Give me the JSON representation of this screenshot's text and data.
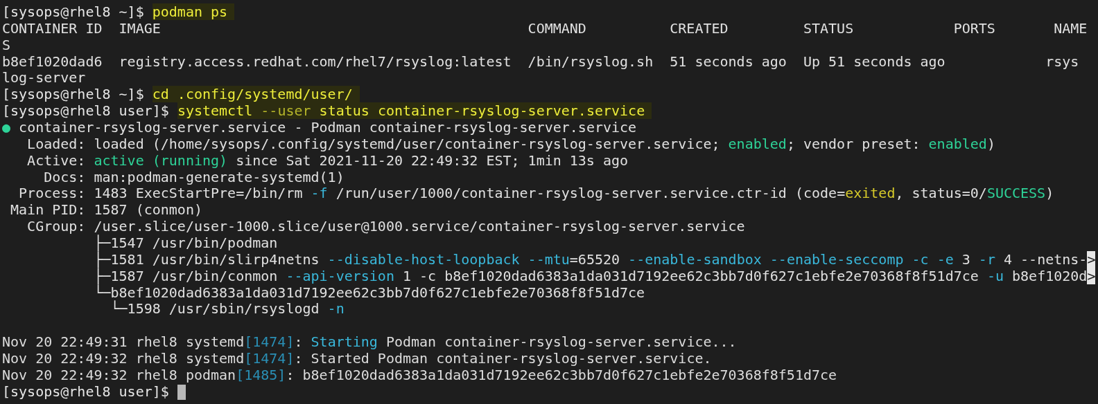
{
  "terminal": {
    "cursor_visible": true,
    "lines": [
      {
        "kind": "prompt",
        "segments": [
          {
            "kind": "plain",
            "text": "[sysops@rhel8 ~]$ "
          },
          {
            "kind": "cmd",
            "text": "podman ps"
          }
        ]
      },
      {
        "kind": "output",
        "segments": [
          {
            "kind": "plain",
            "text": "CONTAINER ID  IMAGE                                            COMMAND          CREATED         STATUS            PORTS       NAME"
          }
        ]
      },
      {
        "kind": "output",
        "segments": [
          {
            "kind": "plain",
            "text": "S"
          }
        ]
      },
      {
        "kind": "output",
        "segments": [
          {
            "kind": "plain",
            "text": "b8ef1020dad6  registry.access.redhat.com/rhel7/rsyslog:latest  /bin/rsyslog.sh  51 seconds ago  Up 51 seconds ago            rsys"
          }
        ]
      },
      {
        "kind": "output",
        "segments": [
          {
            "kind": "plain",
            "text": "log-server"
          }
        ]
      },
      {
        "kind": "prompt",
        "segments": [
          {
            "kind": "plain",
            "text": "[sysops@rhel8 ~]$ "
          },
          {
            "kind": "cmd",
            "text": "cd .config/systemd/user/"
          }
        ]
      },
      {
        "kind": "prompt",
        "segments": [
          {
            "kind": "plain",
            "text": "[sysops@rhel8 user]$ "
          },
          {
            "kind": "cmd",
            "text": "systemctl "
          },
          {
            "kind": "cmd_opt",
            "text": "--user"
          },
          {
            "kind": "cmd",
            "text": " status container-rsyslog-server.service"
          }
        ]
      },
      {
        "kind": "output",
        "segments": [
          {
            "kind": "dot",
            "text": "●"
          },
          {
            "kind": "plain",
            "text": " container-rsyslog-server.service - Podman container-rsyslog-server.service"
          }
        ]
      },
      {
        "kind": "output",
        "segments": [
          {
            "kind": "plain",
            "text": "   Loaded: loaded (/home/sysops/.config/systemd/user/container-rsyslog-server.service; "
          },
          {
            "kind": "green",
            "text": "enabled"
          },
          {
            "kind": "plain",
            "text": "; vendor preset: "
          },
          {
            "kind": "green",
            "text": "enabled"
          },
          {
            "kind": "plain",
            "text": ")"
          }
        ]
      },
      {
        "kind": "output",
        "segments": [
          {
            "kind": "plain",
            "text": "   Active: "
          },
          {
            "kind": "green",
            "text": "active (running)"
          },
          {
            "kind": "plain",
            "text": " since Sat 2021-11-20 22:49:32 EST; 1min 13s ago"
          }
        ]
      },
      {
        "kind": "output",
        "segments": [
          {
            "kind": "plain",
            "text": "     Docs: man:podman-generate-systemd(1)"
          }
        ]
      },
      {
        "kind": "output",
        "segments": [
          {
            "kind": "plain",
            "text": "  Process: 1483 ExecStartPre=/bin/rm "
          },
          {
            "kind": "cyan",
            "text": "-f"
          },
          {
            "kind": "plain",
            "text": " /run/user/1000/container-rsyslog-server.service.ctr-id (code="
          },
          {
            "kind": "yellow",
            "text": "exited"
          },
          {
            "kind": "plain",
            "text": ", status=0/"
          },
          {
            "kind": "green",
            "text": "SUCCESS"
          },
          {
            "kind": "plain",
            "text": ")"
          }
        ]
      },
      {
        "kind": "output",
        "segments": [
          {
            "kind": "plain",
            "text": " Main PID: 1587 (conmon)"
          }
        ]
      },
      {
        "kind": "output",
        "segments": [
          {
            "kind": "plain",
            "text": "   CGroup: /user.slice/user-1000.slice/user@1000.service/container-rsyslog-server.service"
          }
        ]
      },
      {
        "kind": "output",
        "segments": [
          {
            "kind": "plain",
            "text": "           ├─1547 /usr/bin/podman"
          }
        ]
      },
      {
        "kind": "output",
        "segments": [
          {
            "kind": "plain",
            "text": "           ├─1581 /usr/bin/slirp4netns "
          },
          {
            "kind": "cyan",
            "text": "--disable-host-loopback --mtu"
          },
          {
            "kind": "plain",
            "text": "=65520 "
          },
          {
            "kind": "cyan",
            "text": "--enable-sandbox --enable-seccomp -c -e"
          },
          {
            "kind": "plain",
            "text": " 3 "
          },
          {
            "kind": "cyan",
            "text": "-r"
          },
          {
            "kind": "plain",
            "text": " 4 --netns-"
          },
          {
            "kind": "more",
            "text": ">"
          }
        ]
      },
      {
        "kind": "output",
        "segments": [
          {
            "kind": "plain",
            "text": "           ├─1587 /usr/bin/conmon "
          },
          {
            "kind": "cyan",
            "text": "--api-version"
          },
          {
            "kind": "plain",
            "text": " 1 -c b8ef1020dad6383a1da031d7192ee62c3bb7d0f627c1ebfe2e70368f8f51d7ce "
          },
          {
            "kind": "cyan",
            "text": "-u"
          },
          {
            "kind": "plain",
            "text": " b8ef1020d"
          },
          {
            "kind": "more",
            "text": ">"
          }
        ]
      },
      {
        "kind": "output",
        "segments": [
          {
            "kind": "plain",
            "text": "           └─b8ef1020dad6383a1da031d7192ee62c3bb7d0f627c1ebfe2e70368f8f51d7ce"
          }
        ]
      },
      {
        "kind": "output",
        "segments": [
          {
            "kind": "plain",
            "text": "             └─1598 /usr/sbin/rsyslogd "
          },
          {
            "kind": "cyan",
            "text": "-n"
          }
        ]
      },
      {
        "kind": "blank"
      },
      {
        "kind": "log",
        "segments": [
          {
            "kind": "plain",
            "text": "Nov 20 22:49:31 rhel8 systemd"
          },
          {
            "kind": "pid",
            "text": "[1474]"
          },
          {
            "kind": "plain",
            "text": ": "
          },
          {
            "kind": "cyan",
            "text": "Starting"
          },
          {
            "kind": "plain",
            "text": " Podman container-rsyslog-server.service..."
          }
        ]
      },
      {
        "kind": "log",
        "segments": [
          {
            "kind": "plain",
            "text": "Nov 20 22:49:32 rhel8 systemd"
          },
          {
            "kind": "pid",
            "text": "[1474]"
          },
          {
            "kind": "plain",
            "text": ": Started Podman container-rsyslog-server.service."
          }
        ]
      },
      {
        "kind": "log",
        "segments": [
          {
            "kind": "plain",
            "text": "Nov 20 22:49:32 rhel8 podman"
          },
          {
            "kind": "pid",
            "text": "[1485]"
          },
          {
            "kind": "plain",
            "text": ": b8ef1020dad6383a1da031d7192ee62c3bb7d0f627c1ebfe2e70368f8f51d7ce"
          }
        ]
      },
      {
        "kind": "prompt",
        "segments": [
          {
            "kind": "plain",
            "text": "[sysops@rhel8 user]$"
          }
        ]
      }
    ]
  }
}
